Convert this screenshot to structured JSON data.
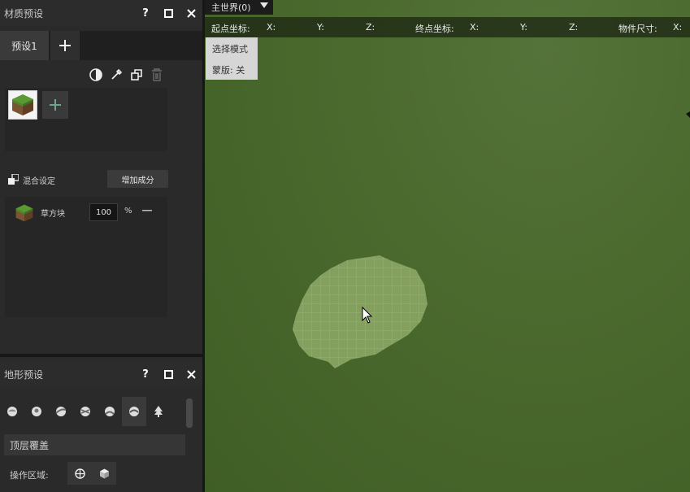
{
  "material_panel": {
    "title": "材质预设",
    "help_label": "?",
    "tab_label": "预设1",
    "mix_label": "混合设定",
    "add_component_label": "增加成分",
    "material": {
      "name": "草方块",
      "percent": "100",
      "unit": "%"
    }
  },
  "terrain_panel": {
    "title": "地形预设",
    "help_label": "?",
    "dropdown_value": "顶层覆盖",
    "region_label": "操作区域:",
    "tools": [
      "brush-tool-1",
      "brush-tool-2",
      "brush-tool-3",
      "brush-tool-4",
      "brush-tool-5",
      "brush-tool-6",
      "tree-tool"
    ],
    "selected_tool_index": 5
  },
  "viewport": {
    "world_label": "主世界(0)",
    "start_label": "起点坐标:",
    "end_label": "终点坐标:",
    "size_label": "物件尺寸:",
    "x_label": "X:",
    "y_label": "Y:",
    "z_label": "Z:",
    "mode_label": "选择模式",
    "mask_label": "蒙版: 关"
  },
  "colors": {
    "grass": "#4b6a2e",
    "panel": "#2a2a2a",
    "accent_add": "#6fa58d"
  }
}
